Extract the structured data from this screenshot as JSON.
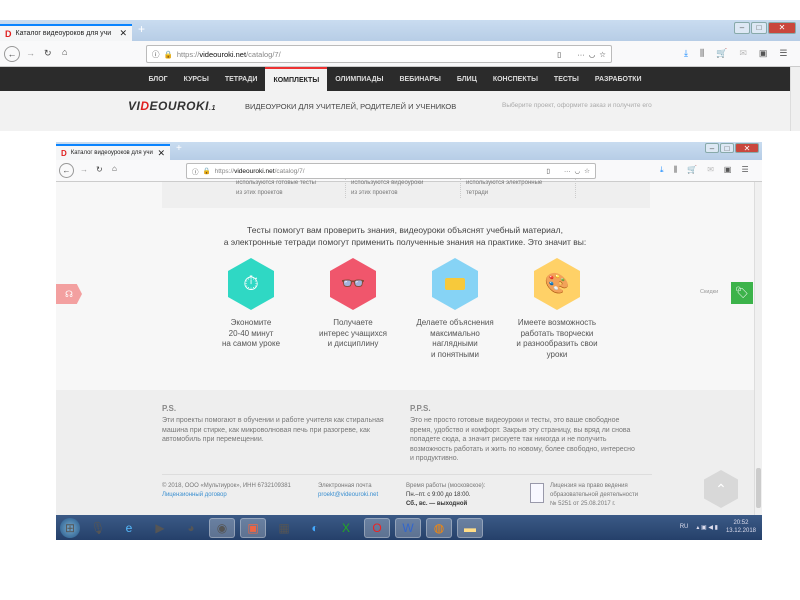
{
  "outer": {
    "tab_title": "Каталог видеоуроков для учи",
    "url_prefix": "https://",
    "url_domain": "videouroki.net",
    "url_path": "/catalog/7/",
    "nav": [
      "БЛОГ",
      "КУРСЫ",
      "ТЕТРАДИ",
      "КОМПЛЕКТЫ",
      "ОЛИМПИАДЫ",
      "ВЕБИНАРЫ",
      "БЛИЦ",
      "КОНСПЕКТЫ",
      "ТЕСТЫ",
      "РАЗРАБОТКИ"
    ],
    "active_nav": "КОМПЛЕКТЫ",
    "logo": "VIDEOUROKI",
    "tagline": "ВИДЕОУРОКИ ДЛЯ УЧИТЕЛЕЙ, РОДИТЕЛЕЙ И УЧЕНИКОВ",
    "subtagline": "Выберите проект, оформите заказ и получите его"
  },
  "inner": {
    "tab_title": "Каталог видеоуроков для учи",
    "url_prefix": "https://",
    "url_domain": "videouroki.net",
    "url_path": "/catalog/7/",
    "cards": [
      {
        "l1": "используются готовые тесты",
        "l2": "из этих проектов"
      },
      {
        "l1": "используются видеоуроки",
        "l2": "из этих проектов"
      },
      {
        "l1": "используются электронные",
        "l2": "тетради"
      }
    ],
    "intro_line1": "Тесты помогут вам проверить знания, видеоуроки объяснят учебный материал,",
    "intro_line2": "а электронные тетради помогут применить полученные знания на практике. Это значит вы:",
    "features": [
      {
        "icon": "stopwatch-icon",
        "color": "#2fd8c4",
        "lines": [
          "Экономите",
          "20-40 минут",
          "на самом уроке"
        ]
      },
      {
        "icon": "glasses-icon",
        "color": "#f0566c",
        "lines": [
          "Получаете",
          "интерес учащихся",
          "и дисциплину"
        ]
      },
      {
        "icon": "lego-brick-icon",
        "color": "#86d3f5",
        "lines": [
          "Делаете объяснения",
          "максимально",
          "наглядными",
          "и понятными"
        ]
      },
      {
        "icon": "palette-icon",
        "color": "#ffd167",
        "lines": [
          "Имеете возможность",
          "работать творчески",
          "и разнообразить свои",
          "уроки"
        ]
      }
    ],
    "discounts_label": "Скидки",
    "ps_title": "P.S.",
    "ps_text": "Эти проекты помогают в обучении и работе учителя как стиральная машина при стирке, как микроволновая печь при разогреве, как автомобиль при перемещении.",
    "pps_title": "P.P.S.",
    "pps_text": "Это не просто готовые видеоуроки и тесты, это ваше свободное время, удобство и комфорт. Закрыв эту страницу, вы вряд ли снова попадете сюда, а значит рискуете так никогда и не получить возможность работать и жить по новому, более свободно, интересно и продуктивно.",
    "footer": {
      "copyright": "© 2018, ООО «Мультиурок», ИНН 6732109381",
      "license_link": "Лицензионный договор",
      "email_label": "Электронная почта",
      "email": "proekt@videouroki.net",
      "hours_label": "Время работы (московское):",
      "hours1": "Пн.–пт. с 9:00 до 18:00.",
      "hours2": "Сб., вс. — выходной",
      "lic1": "Лицензия на право ведения",
      "lic2": "образовательной деятельности",
      "lic3": "№ 5251 от 25.08.2017 г."
    }
  },
  "taskbar": {
    "lang": "RU",
    "time": "20:52",
    "date": "13.12.2018"
  },
  "colors": {
    "accent": "#e02020",
    "nav_bg": "#2b2b2b",
    "discount": "#3cb34a"
  }
}
